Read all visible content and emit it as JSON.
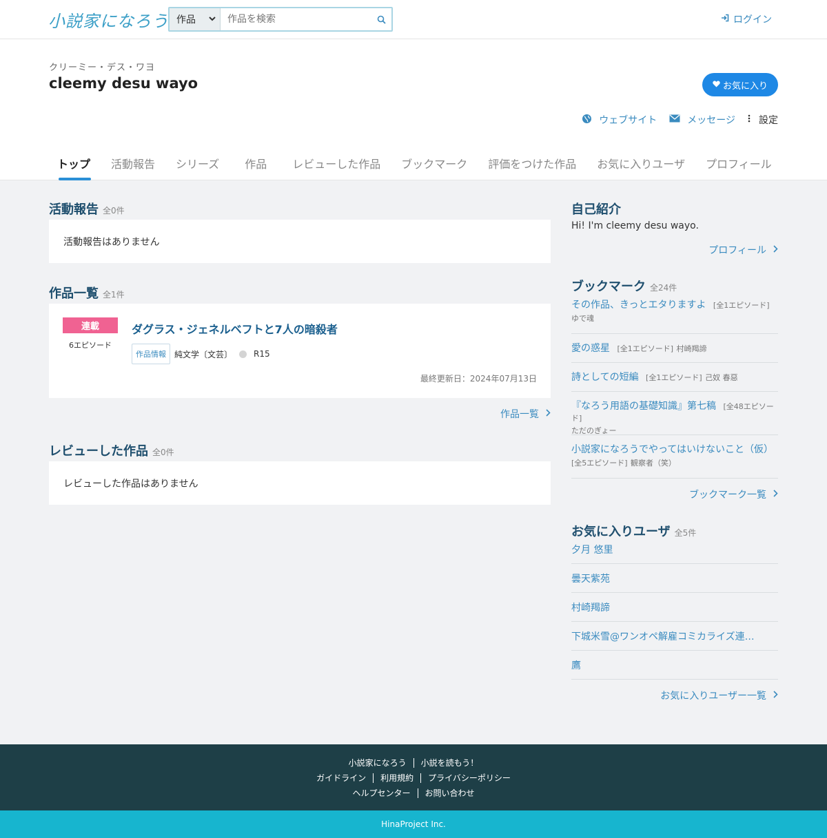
{
  "header": {
    "logo_text": "小説家になろう",
    "search_category": "作品",
    "search_placeholder": "作品を検索",
    "login_label": "ログイン"
  },
  "profile": {
    "kana": "クリーミー・デス・ワヨ",
    "name": "cleemy desu wayo",
    "favorite_button": "お気に入り",
    "website_label": "ウェブサイト",
    "message_label": "メッセージ",
    "settings_label": "設定"
  },
  "tabs": [
    "トップ",
    "活動報告",
    "シリーズ",
    "作品",
    "レビューした作品",
    "ブックマーク",
    "評価をつけた作品",
    "お気に入りユーザ",
    "プロフィール"
  ],
  "activity": {
    "title": "活動報告",
    "count": "全0件",
    "empty": "活動報告はありません"
  },
  "works": {
    "title": "作品一覧",
    "count": "全1件",
    "item": {
      "status": "連載",
      "episodes": "6エピソード",
      "title": "ダグラス・ジェネルベフトと7人の暗殺者",
      "info_chip": "作品情報",
      "genre": "純文学〔文芸〕",
      "rating": "R15",
      "updated": "最終更新日：2024年07月13日"
    },
    "more": "作品一覧"
  },
  "reviews": {
    "title": "レビューした作品",
    "count": "全0件",
    "empty": "レビューした作品はありません"
  },
  "intro": {
    "title": "自己紹介",
    "text": "Hi! I'm cleemy desu wayo.",
    "more": "プロフィール"
  },
  "bookmarks": {
    "title": "ブックマーク",
    "count": "全24件",
    "items": [
      {
        "title": "その作品、きっとエタりますよ",
        "meta": "[全1エピソード]",
        "author": "ゆで魂"
      },
      {
        "title": "愛の惑星",
        "meta": "[全1エピソード]",
        "author": "村崎羯諦"
      },
      {
        "title": "詩としての短編",
        "meta": "[全1エピソード]",
        "author": "己奴 春惡"
      },
      {
        "title": "『なろう用語の基礎知識』第七稿",
        "meta": "[全48エピソード]",
        "author": "ただのぎょー"
      },
      {
        "title": "小説家になろうでやってはいけないこと（仮）",
        "meta": "[全5エピソード]",
        "author": "観察者（笑）"
      }
    ],
    "more": "ブックマーク一覧"
  },
  "favorite_users": {
    "title": "お気に入りユーザ",
    "count": "全5件",
    "items": [
      "夕月 悠里",
      "曇天紫苑",
      "村崎羯諦",
      "下城米雪@ワンオペ解雇コミカライズ連…",
      "鷹"
    ],
    "more": "お気に入りユーザー一覧"
  },
  "footer": {
    "row1": [
      "小説家になろう",
      "小説を読もう！"
    ],
    "row2": [
      "ガイドライン",
      "利用規約",
      "プライバシーポリシー"
    ],
    "row3": [
      "ヘルプセンター",
      "お問い合わせ"
    ],
    "copyright": "HinaProject Inc."
  },
  "colors": {
    "accent": "#1e88e5",
    "link": "#3a8bbf",
    "badge": "#f06292",
    "footer_bg": "#1e3f47",
    "copyright_bg": "#17b5cf"
  }
}
